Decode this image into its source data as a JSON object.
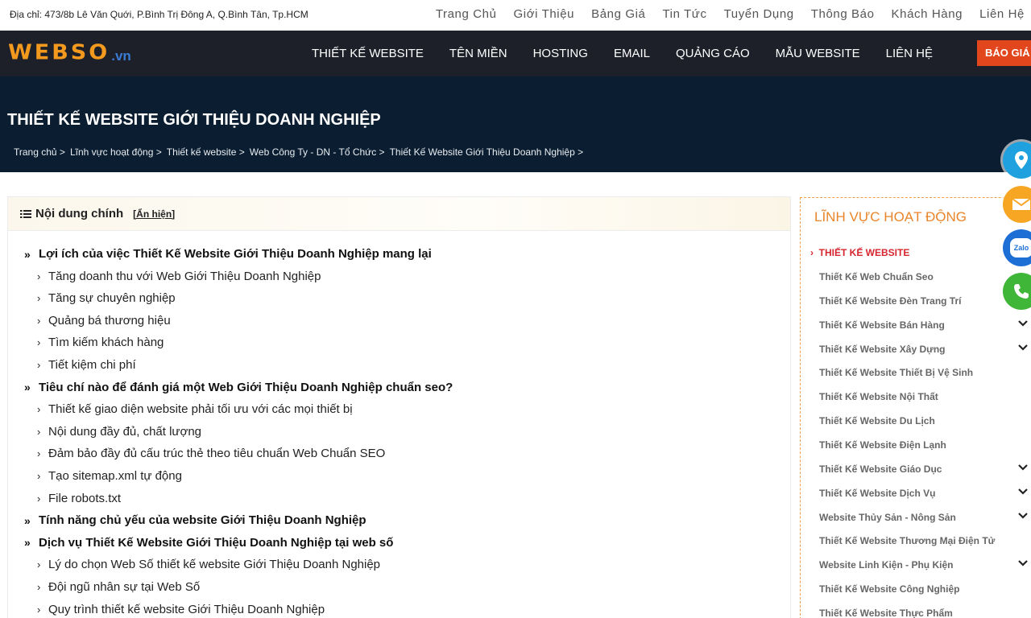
{
  "topbar": {
    "address": "Địa chỉ: 473/8b Lê Văn Quới, P.Bình Trị Đông A, Q.Bình Tân, Tp.HCM",
    "links": [
      "Trang Chủ",
      "Giới Thiệu",
      "Bảng Giá",
      "Tin Tức",
      "Tuyển Dụng",
      "Thông Báo",
      "Khách Hàng",
      "Liên Hệ"
    ]
  },
  "header": {
    "logo_main": "WEBSO",
    "logo_suffix": ".vn",
    "menu": [
      "THIẾT KẾ WEBSITE",
      "TÊN MIỀN",
      "HOSTING",
      "EMAIL",
      "QUẢNG CÁO",
      "MẪU WEBSITE",
      "LIÊN HỆ"
    ],
    "quote_button": "BÁO GIÁ"
  },
  "banner": {
    "title": "THIẾT KẾ WEBSITE GIỚI THIỆU DOANH NGHIỆP",
    "breadcrumb": [
      "Trang chủ >",
      "Lĩnh vực hoạt động >",
      "Thiết kế website >",
      "Web Công Ty - DN - Tổ Chức >",
      "Thiết Kế Website Giới Thiệu Doanh Nghiệp >"
    ]
  },
  "toc": {
    "title": "Nội dung chính",
    "toggle": "[Ẩn hiện]",
    "items": [
      {
        "level": 2,
        "text": "Lợi ích của việc Thiết Kế Website Giới Thiệu Doanh Nghiệp mang lại"
      },
      {
        "level": 3,
        "text": "Tăng doanh thu với Web Giới Thiệu Doanh Nghiệp"
      },
      {
        "level": 3,
        "text": "Tăng sự chuyên nghiệp"
      },
      {
        "level": 3,
        "text": "Quảng bá thương hiệu"
      },
      {
        "level": 3,
        "text": "Tìm kiếm khách hàng"
      },
      {
        "level": 3,
        "text": "Tiết kiệm chi phí"
      },
      {
        "level": 2,
        "text": "Tiêu chí nào để đánh giá một Web Giới Thiệu Doanh Nghiệp chuẩn seo?"
      },
      {
        "level": 3,
        "text": "Thiết kế giao diện website phải tối ưu với các mọi thiết bị"
      },
      {
        "level": 3,
        "text": "Nội dung đầy đủ, chất lượng"
      },
      {
        "level": 3,
        "text": "Đảm bảo đầy đủ cấu trúc thẻ theo tiêu chuẩn Web Chuẩn SEO"
      },
      {
        "level": 3,
        "text": "Tạo sitemap.xml tự động"
      },
      {
        "level": 3,
        "text": "File robots.txt"
      },
      {
        "level": 2,
        "text": "Tính năng chủ yếu của website Giới Thiệu Doanh Nghiệp"
      },
      {
        "level": 2,
        "text": "Dịch vụ Thiết Kế Website Giới Thiệu Doanh Nghiệp tại web số"
      },
      {
        "level": 3,
        "text": "Lý do chọn Web Số thiết kế website Giới Thiệu Doanh Nghiệp"
      },
      {
        "level": 3,
        "text": "Đội ngũ nhân sự tại Web Số"
      },
      {
        "level": 3,
        "text": "Quy trình thiết kế website Giới Thiệu Doanh Nghiệp"
      }
    ]
  },
  "sidebar": {
    "title": "LĨNH VỰC HOẠT ĐỘNG",
    "active": "THIẾT KẾ WEBSITE",
    "items": [
      {
        "text": "Thiết Kế Web Chuẩn Seo",
        "expandable": false
      },
      {
        "text": "Thiết Kế Website Đèn Trang Trí",
        "expandable": false
      },
      {
        "text": "Thiết Kế Website Bán Hàng",
        "expandable": true
      },
      {
        "text": "Thiết Kế Website Xây Dựng",
        "expandable": true
      },
      {
        "text": "Thiết Kế Website Thiết Bị Vệ Sinh",
        "expandable": false
      },
      {
        "text": "Thiết Kế Website Nội Thất",
        "expandable": false
      },
      {
        "text": "Thiết Kế Website Du Lịch",
        "expandable": false
      },
      {
        "text": "Thiết Kế Website Điện Lạnh",
        "expandable": false
      },
      {
        "text": "Thiết Kế Website Giáo Dục",
        "expandable": true
      },
      {
        "text": "Thiết Kế Website Dịch Vụ",
        "expandable": true
      },
      {
        "text": "Website Thủy Sản - Nông Sản",
        "expandable": true
      },
      {
        "text": "Thiết Kế Website Thương Mại Điện Tử",
        "expandable": false
      },
      {
        "text": "Website Linh Kiện - Phụ Kiện",
        "expandable": true
      },
      {
        "text": "Thiết Kế Website Công Nghiệp",
        "expandable": false
      },
      {
        "text": "Thiết Kế Website Thực Phẩm",
        "expandable": false
      }
    ]
  },
  "floating": {
    "zalo_label": "Zalo",
    "icons": [
      "map-pin-icon",
      "email-icon",
      "zalo-icon",
      "phone-icon"
    ]
  },
  "colors": {
    "nav_bg": "#1d2029",
    "banner_bg": "#0b1d30",
    "accent_orange": "#e8852a",
    "quote_red": "#e2461d",
    "active_red": "#d7262f"
  }
}
